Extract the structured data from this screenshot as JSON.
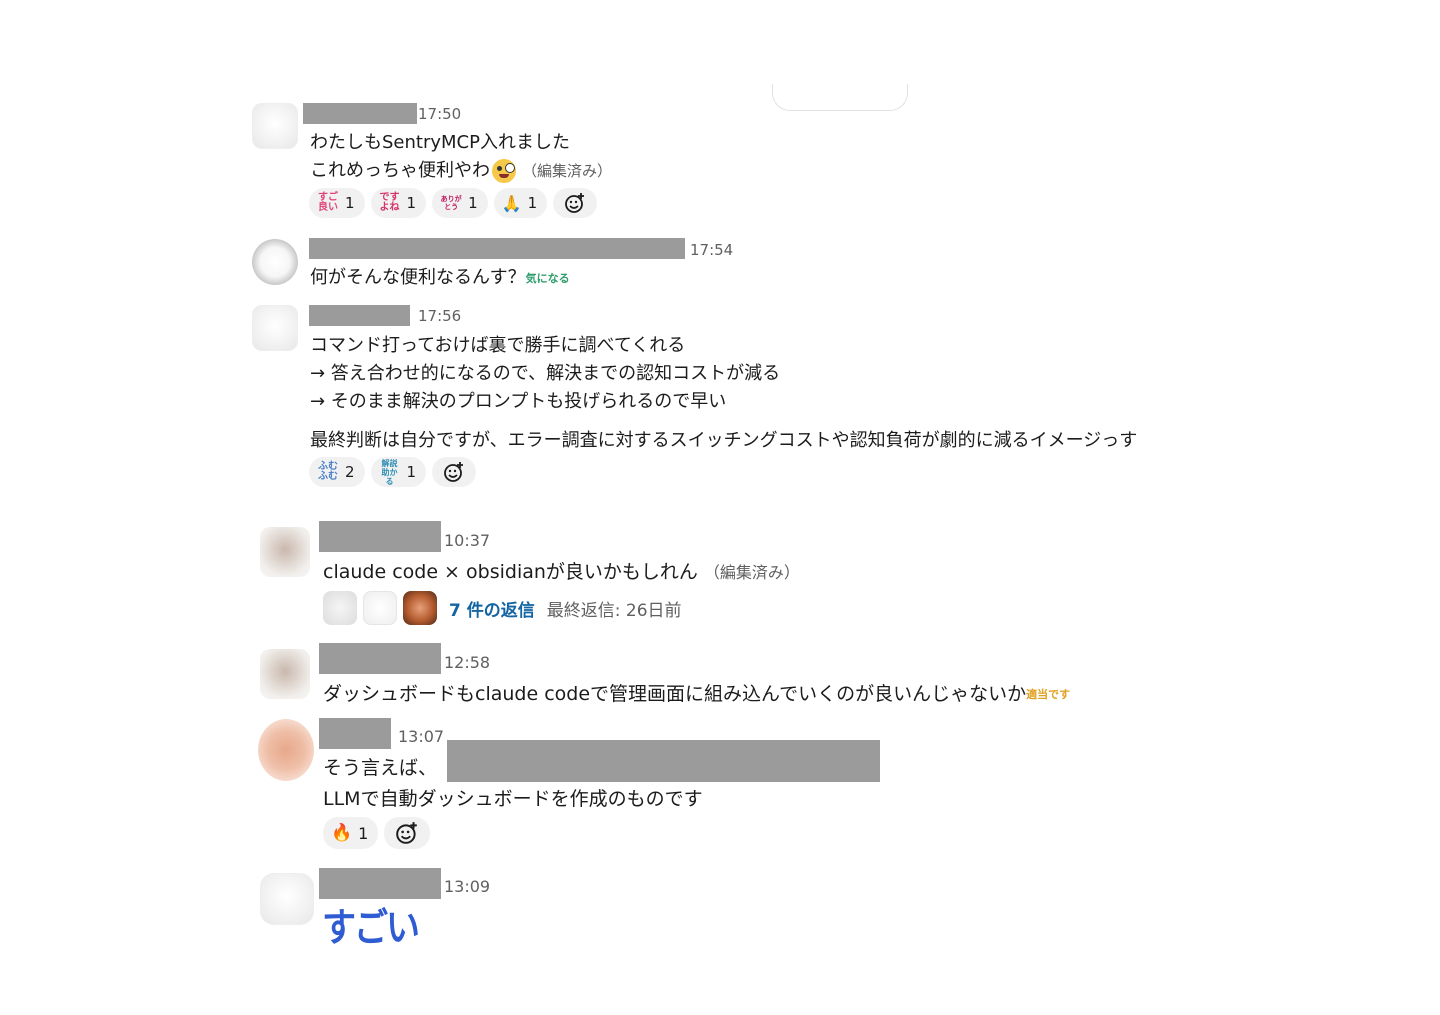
{
  "messages": [
    {
      "time": "17:50",
      "lines": [
        "わたしもSentryMCP入れました",
        "これめっちゃ便利やわ"
      ],
      "edited": "（編集済み）",
      "reactions": [
        {
          "icon": "sugoi-yoi-stamp",
          "stamp": "すご良い",
          "count": "1",
          "color": "#e0447a"
        },
        {
          "icon": "desuyone-stamp",
          "stamp": "ですよね",
          "count": "1",
          "color": "#d6336c"
        },
        {
          "icon": "arigatou-stamp",
          "stamp": "ありがとう",
          "count": "1",
          "color": "#c2185b"
        },
        {
          "icon": "folded-hands-emoji",
          "stamp": "🙏",
          "count": "1",
          "color": "#d9a066"
        }
      ]
    },
    {
      "time": "17:54",
      "text": "何がそんな便利なるんす？",
      "stamp": {
        "text": "気になる",
        "color": "#2e9e6b"
      }
    },
    {
      "time": "17:56",
      "lines": [
        "コマンド打っておけば裏で勝手に調べてくれる",
        "→ 答え合わせ的になるので、解決までの認知コストが減る",
        "→ そのまま解決のプロンプトも投げられるので早い"
      ],
      "line4": "最終判断は自分ですが、エラー調査に対するスイッチングコストや認知負荷が劇的に減るイメージっす",
      "reactions": [
        {
          "icon": "fumufumu-stamp",
          "stamp": "ふむふむ",
          "count": "2",
          "color": "#4a7fc9"
        },
        {
          "icon": "kaisetsu-tasukaru-stamp",
          "stamp": "解説助かる",
          "count": "1",
          "color": "#2f8fb5"
        }
      ]
    },
    {
      "time": "10:37",
      "text": "claude code × obsidianが良いかもしれん",
      "edited": "（編集済み）",
      "thread": {
        "replies": "7 件の返信",
        "last": "最終返信: 26日前"
      }
    },
    {
      "time": "12:58",
      "text": "ダッシュボードもclaude codeで管理画面に組み込んでいくのが良いんじゃないか",
      "stamp": {
        "text": "適当です",
        "color": "#e0a020"
      }
    },
    {
      "time": "13:07",
      "line1": "そう言えば、",
      "line2": "LLMで自動ダッシュボードを作成のものです",
      "reactions": [
        {
          "icon": "fire-emoji",
          "stamp": "🔥",
          "count": "1",
          "color": "#e8590c"
        }
      ]
    },
    {
      "time": "13:09",
      "text": "すごい"
    }
  ]
}
